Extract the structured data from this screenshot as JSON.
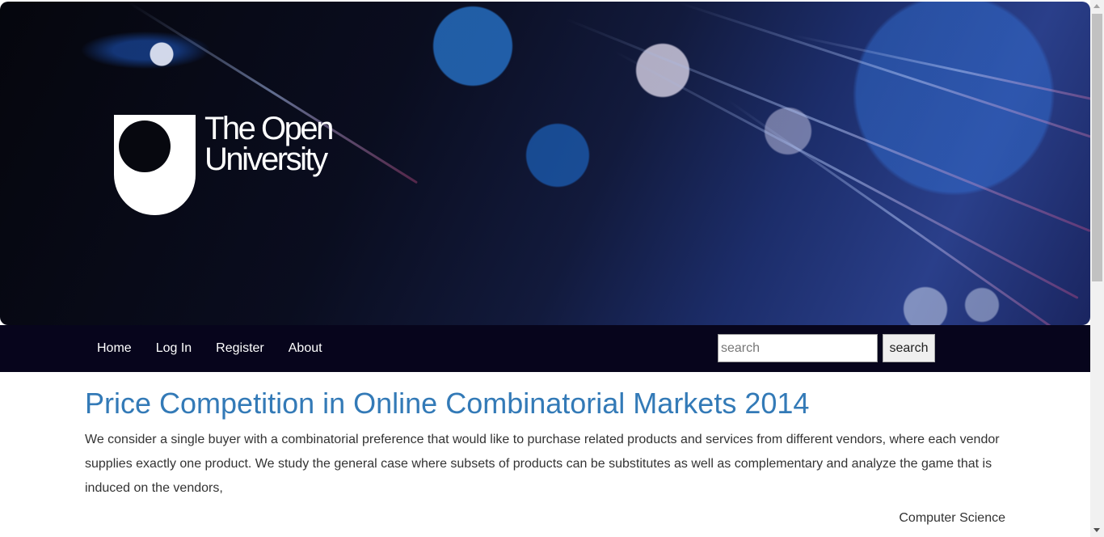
{
  "brand": {
    "logo_line1": "The Open",
    "logo_line2": "University"
  },
  "nav": {
    "items": [
      {
        "label": "Home"
      },
      {
        "label": "Log In"
      },
      {
        "label": "Register"
      },
      {
        "label": "About"
      }
    ],
    "search_placeholder": "search",
    "search_button_label": "search"
  },
  "article": {
    "title": "Price Competition in Online Combinatorial Markets 2014",
    "abstract": "We consider a single buyer with a combinatorial preference that would like to purchase related products and services from different vendors, where each vendor supplies exactly one product. We study the general case where subsets of products can be substitutes as well as complementary and analyze the game that is induced on the vendors,",
    "category": "Computer Science"
  },
  "colors": {
    "nav_background": "#07051c",
    "title_color": "#337ab7",
    "text_color": "#333333"
  },
  "icons": {
    "logo": "open-university-shield-icon",
    "scroll_up": "chevron-up-icon",
    "scroll_down": "chevron-down-icon"
  }
}
